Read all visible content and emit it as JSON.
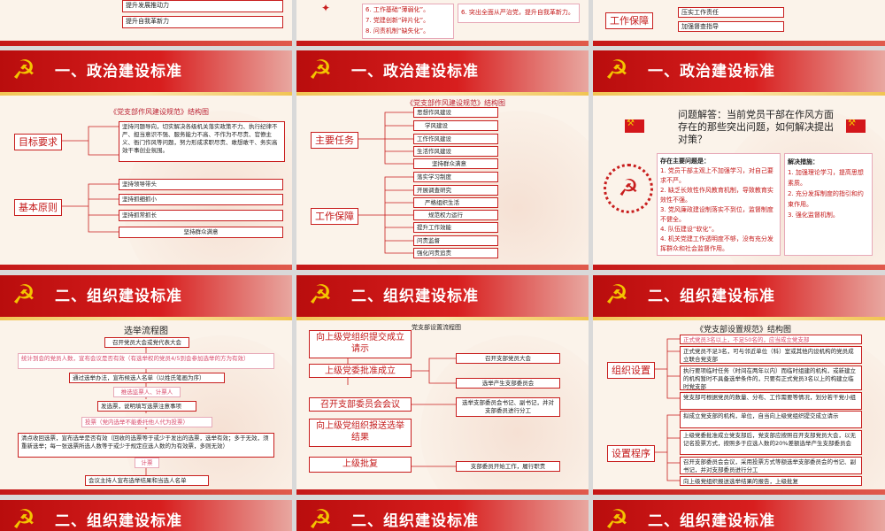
{
  "colors": {
    "header_red": "#c81e1e",
    "emblem_gold": "#f4c400",
    "box_border": "#c81e1e",
    "pink_text": "#d94a6a"
  },
  "top_row": {
    "left": {
      "items": [
        "提升发展推动力",
        "提升自我革新力"
      ]
    },
    "middle": {
      "col1": [
        "6. 工作基础“薄弱化”。",
        "7. 党建创新“碎片化”。",
        "8. 问责机制“缺失化”。"
      ],
      "col2": [
        "6. 突出全面从严治党，提升自我革新力。"
      ]
    },
    "right": {
      "label": "工作保障",
      "items": [
        "压实工作责任",
        "加强督查指导"
      ]
    }
  },
  "slides": {
    "s1": {
      "header": "一、政治建设标准",
      "chart_title": "《党支部作风建设规范》结构图",
      "label_a": "目标要求",
      "text_a": "坚持问题导向，切实解决各级机关落实政策不力、执行纪律不严、担当意识不强、服务能力不高、不作为不尽责、官僚主义、衙门作风等问题，努力形成求职尽责、敢想敢干、务实高效干事创业氛围。",
      "label_b": "基本原则",
      "items_b": [
        "坚持领导带头",
        "坚持抓细抓小",
        "坚持抓常抓长",
        "坚持群众满意"
      ]
    },
    "s2": {
      "header": "一、政治建设标准",
      "chart_title": "《党支部作风建设规范》结构图",
      "label_a": "主要任务",
      "items_a": [
        "思想作风建设",
        "学风建设",
        "工作作风建设",
        "生活作风建设",
        "坚持群众满意"
      ],
      "label_b": "工作保障",
      "items_b": [
        "落实学习制度",
        "开展调查研究",
        "严格组织生活",
        "规范权力运行",
        "提升工作效能",
        "问责监督",
        "强化问责追责"
      ]
    },
    "s3": {
      "header": "一、政治建设标准",
      "question": "问题解答：当前党员干部在作风方面存在的那些突出问题，如何解决提出对策？",
      "issues_title": "存在主要问题是：",
      "issues": [
        "1. 党员干部主观上不加强学习，对自己要求不严。",
        "2. 缺乏长效性作风教育机制，导致教育实效性不强。",
        "3. 党风廉政建设制落实不到位，监督制度不健全。",
        "4. 队伍建设“软化”。",
        "4. 机关党建工作透明度不够，没有充分发挥群众和社会监督作用。"
      ],
      "measures_title": "解决措施：",
      "measures": [
        "1. 加强理论学习，提高思想素质。",
        "2. 充分发挥制度的指引和约束作用。",
        "3. 强化监督机制。"
      ]
    },
    "s4": {
      "header": "二、组织建设标准",
      "chart_title": "选举流程图",
      "steps": [
        {
          "text": "召开党员大会或党代表大会",
          "pink": false
        },
        {
          "text": "统计到会的党员人数，宣布会议是否有效（有选举权的党员4/5到会参加选举的方为有效）",
          "pink": true
        },
        {
          "text": "通过选举办法，宣布候选人名单（以姓氏笔画为序）",
          "pink": false
        },
        {
          "text": "推选监票人、计票人",
          "pink": true
        },
        {
          "text": "发选票，说明填写选票注意事项",
          "pink": false
        },
        {
          "text": "投票（党内选举不能委托他人代为投票）",
          "pink": true
        },
        {
          "text": "清点收回选票，宣布选举是否有效（回收的选票等于或少于发出的选票，选举有效；多于无效，须重新选举；每一张选票所选人数等于或少于规定应选人数的为有效票，多则无效）",
          "pink": false
        },
        {
          "text": "计票",
          "pink": true
        },
        {
          "text": "会议主持人宣布选举结果和当选人名单",
          "pink": false
        }
      ]
    },
    "s5": {
      "header": "二、组织建设标准",
      "chart_title": "党支部设置流程图",
      "steps": [
        "向上级党组织提交成立请示",
        "上级党委批准成立",
        "召开支部委员会会议",
        "向上级党组织报送选举结果",
        "上级批复"
      ],
      "notes": [
        "召开支部党员大会",
        "选举产生支部委员会",
        "选举支部委员会书记、副书记，并对支部委员进行分工",
        "支部委员开始工作，履行职责"
      ]
    },
    "s6": {
      "header": "二、组织建设标准",
      "chart_title": "《党支部设置规范》结构图",
      "label_a": "组织设置",
      "items_a": [
        "正式党员3名以上，不足50名的，应当成立党支部",
        "正式党员不足3名，可与邻近单位（科）室或其他内设机构的党员成立联合党支部",
        "执行要项临时任务（时间在两年以内）而临时组建的机构，或新建立的机构暂时不具备选举条件的，只要有正式党员3名以上的构建立临时党支部",
        "党支部可根据党员的数量、分布、工作需要等情况，划分若干党小组"
      ],
      "label_b": "设置程序",
      "items_b": [
        "拟成立党支部的机构，单位，自当向上级党组织提交成立请示",
        "上级党委批准成立党支部后，党支部应按照召开支部党员大会，以无记名投票方式，按照多于应选人数的20%差额选举产生支部委员会",
        "召开支部委员会会议，采用投票方式等额选举支部委员会的书记、副书记，并对支部委员进行分工",
        "向上级党组织报送选举结果的报告，上级批复"
      ]
    },
    "bottom": {
      "h1": "二、组织建设标准",
      "h2": "二、组织建设标准",
      "h3": "二、组织建设标准"
    }
  }
}
